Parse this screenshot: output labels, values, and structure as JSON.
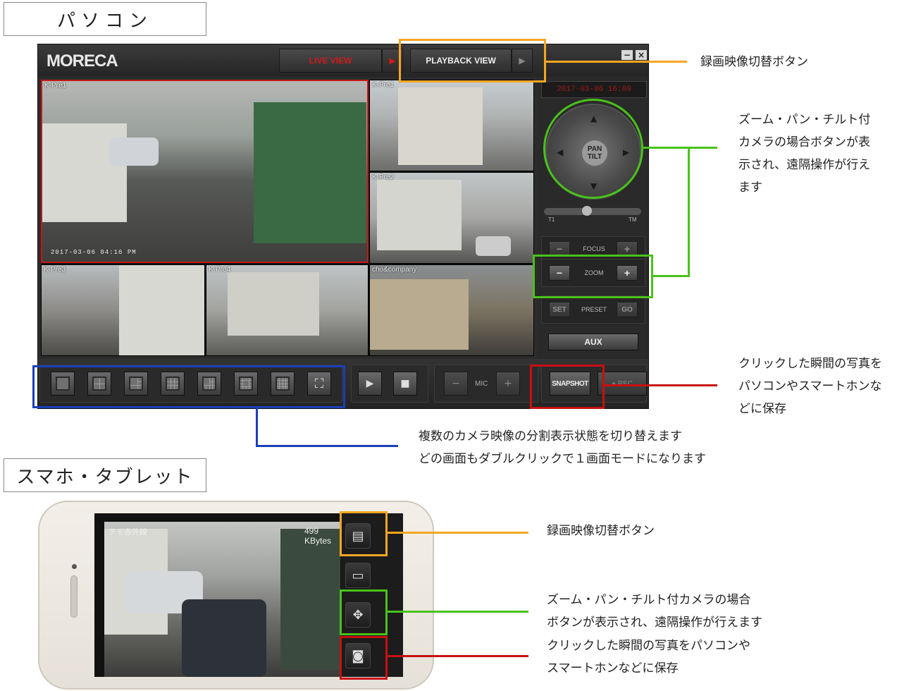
{
  "sections": {
    "pc_label": "パソコン",
    "mobile_label": "スマホ・タブレット"
  },
  "app": {
    "logo": "MORECA",
    "live_view_label": "LIVE VIEW",
    "playback_view_label": "PLAYBACK VIEW",
    "window_minimize_icon": "minimize-icon",
    "window_close_icon": "close-icon",
    "datetime": "2017-03-06  16:09",
    "cameras": [
      {
        "label": "K-Pre1",
        "timestamp": "2017-03-06 04:16 PM"
      },
      {
        "label": "K-Pre1",
        "timestamp": ""
      },
      {
        "label": "K-Pre2",
        "timestamp": ""
      },
      {
        "label": "K-Pre3",
        "timestamp": ""
      },
      {
        "label": "K-Pre4",
        "timestamp": ""
      },
      {
        "label": "cho&company",
        "timestamp": ""
      }
    ],
    "ptz": {
      "center_line1": "PAN",
      "center_line2": "TILT"
    },
    "slider": {
      "left": "T1",
      "right": "TM"
    },
    "focus": {
      "label": "FOCUS",
      "minus": "−",
      "plus": "+"
    },
    "zoom": {
      "label": "ZOOM",
      "minus": "−",
      "plus": "+"
    },
    "preset": {
      "label": "PRESET",
      "set": "SET",
      "go": "GO"
    },
    "aux_label": "AUX",
    "mic_label": "MIC",
    "mic_minus": "−",
    "mic_plus": "+",
    "snapshot_label": "SNAPSHOT",
    "rec_label": "● REC",
    "layouts": [
      "1",
      "4",
      "6",
      "9",
      "10",
      "13",
      "16",
      "fullscreen"
    ]
  },
  "phone": {
    "camera_label": "テモ赤外線",
    "rate": "499 KBytes",
    "buttons": [
      "playback-icon",
      "single-view-icon",
      "ptz-move-icon",
      "camera-snapshot-icon"
    ]
  },
  "annotations": {
    "pc_playback": "録画映像切替ボタン",
    "pc_ptz": [
      "ズーム・パン・チルト付",
      "カメラの場合ボタンが表",
      "示され、遠隔操作が行え",
      "ます"
    ],
    "pc_snapshot": [
      "クリックした瞬間の写真を",
      "パソコンやスマートホンな",
      "どに保存"
    ],
    "pc_layout": [
      "複数のカメラ映像の分割表示状態を切り替えます",
      "どの画面もダブルクリックで１画面モードになります"
    ],
    "m_playback": "録画映像切替ボタン",
    "m_ptz": [
      "ズーム・パン・チルト付カメラの場合",
      "ボタンが表示され、遠隔操作が行えます"
    ],
    "m_snapshot": [
      "クリックした瞬間の写真をパソコンや",
      "スマートホンなどに保存"
    ]
  },
  "colors": {
    "orange": "#f5a623",
    "green": "#49c21a",
    "red": "#c81010",
    "blue": "#1a3fb8"
  }
}
